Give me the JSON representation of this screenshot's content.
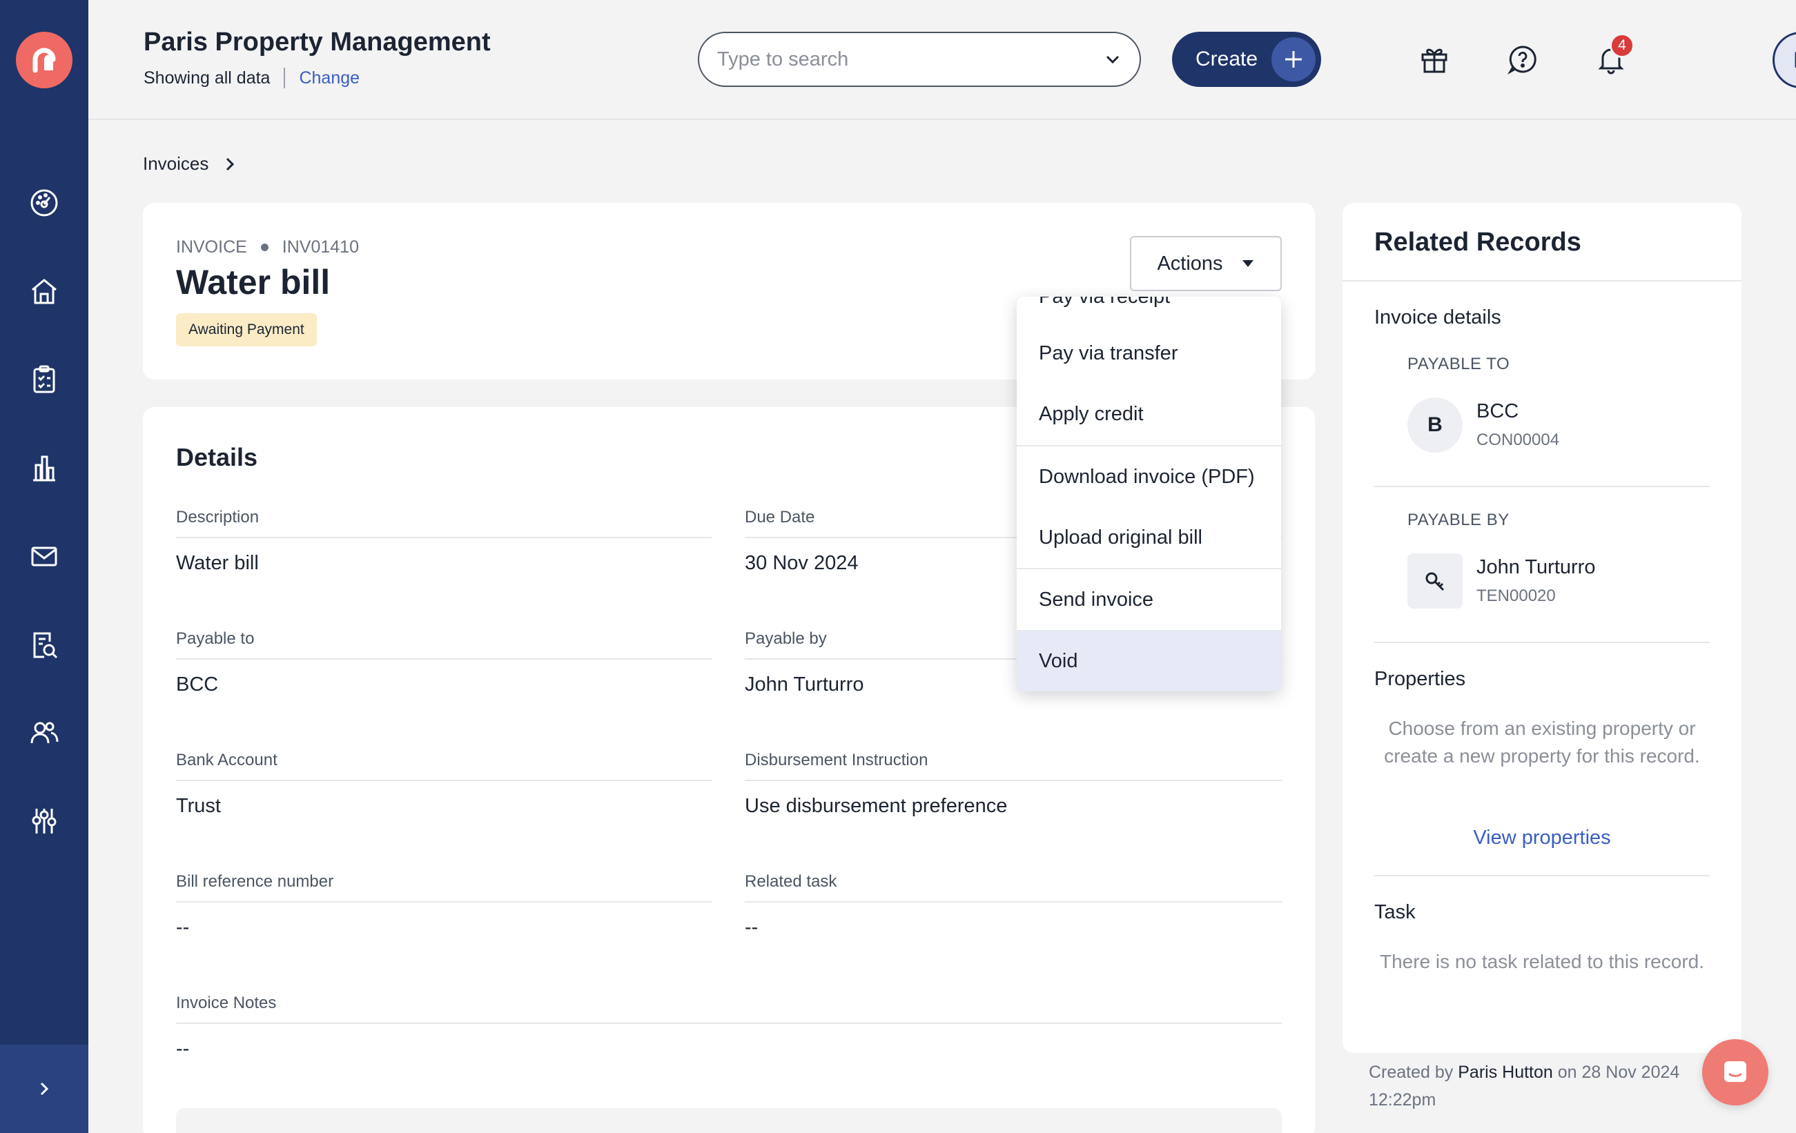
{
  "header": {
    "org_name": "Paris Property Management",
    "showing": "Showing all data",
    "change": "Change",
    "search_placeholder": "Type to search",
    "create_label": "Create",
    "notification_count": "4",
    "avatar_initial": "P"
  },
  "sidebar": {
    "items": [
      "dashboard-icon",
      "properties-icon",
      "tasks-icon",
      "reports-icon",
      "messages-icon",
      "search-records-icon",
      "contacts-icon",
      "settings-icon"
    ]
  },
  "breadcrumb": {
    "items": [
      "Invoices"
    ]
  },
  "invoice": {
    "type_label": "INVOICE",
    "number": "INV01410",
    "title": "Water bill",
    "status": "Awaiting Payment",
    "actions_label": "Actions"
  },
  "details": {
    "title": "Details",
    "fields": [
      {
        "label": "Description",
        "value": "Water bill"
      },
      {
        "label": "Due Date",
        "value": "30 Nov 2024"
      },
      {
        "label": "Payable to",
        "value": "BCC"
      },
      {
        "label": "Payable by",
        "value": "John Turturro"
      },
      {
        "label": "Bank Account",
        "value": "Trust"
      },
      {
        "label": "Disbursement Instruction",
        "value": "Use disbursement preference"
      },
      {
        "label": "Bill reference number",
        "value": "--"
      },
      {
        "label": "Related task",
        "value": "--"
      },
      {
        "label": "Invoice Notes",
        "value": "--"
      }
    ]
  },
  "actions_menu": {
    "items": [
      "Pay via receipt",
      "Pay via transfer",
      "Apply credit",
      "Download invoice (PDF)",
      "Upload original bill",
      "Send invoice",
      "Void"
    ],
    "highlighted": "Void"
  },
  "related": {
    "title": "Related Records",
    "invoice_details": "Invoice details",
    "payable_to_label": "PAYABLE TO",
    "payable_to_initial": "B",
    "payable_to_name": "BCC",
    "payable_to_code": "CON00004",
    "payable_by_label": "PAYABLE BY",
    "payable_by_name": "John Turturro",
    "payable_by_code": "TEN00020",
    "properties_title": "Properties",
    "properties_help": "Choose from an existing property or create a new property for this record.",
    "view_properties": "View properties",
    "task_title": "Task",
    "task_help": "There is no task related to this record."
  },
  "footer": {
    "created_prefix": "Created by",
    "created_by": "Paris Hutton",
    "created_on": "on 28 Nov 2024 12:22pm"
  },
  "colors": {
    "sidebar": "#1f3468",
    "accent": "#3a5ec0",
    "brand": "#ef6a64",
    "status_bg": "#fbecc6",
    "highlight": "#e6eaf6"
  }
}
